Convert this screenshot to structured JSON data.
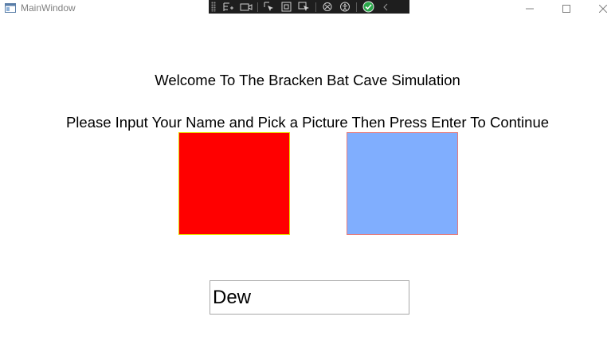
{
  "window": {
    "title": "MainWindow",
    "controls": [
      "minimize-icon",
      "maximize-icon",
      "close-icon"
    ]
  },
  "debug_toolbar": {
    "buttons": [
      "live-visual-tree-icon",
      "select-element-icon",
      "display-adorners-icon",
      "track-focus-icon",
      "binding-failures-icon",
      "accessibility-icon",
      "check-icon",
      "collapse-chevron-icon"
    ]
  },
  "main": {
    "welcome_text": "Welcome To The Bracken Bat Cave Simulation",
    "instructions_text": "Please Input Your Name and Pick a Picture Then Press Enter To Continue",
    "pictures": [
      {
        "name": "red",
        "color": "#ff0000",
        "border": "#e8d800"
      },
      {
        "name": "blue",
        "color": "#80aefe",
        "border": "#e47d7d"
      }
    ],
    "name_input": {
      "value": "Dew"
    }
  }
}
